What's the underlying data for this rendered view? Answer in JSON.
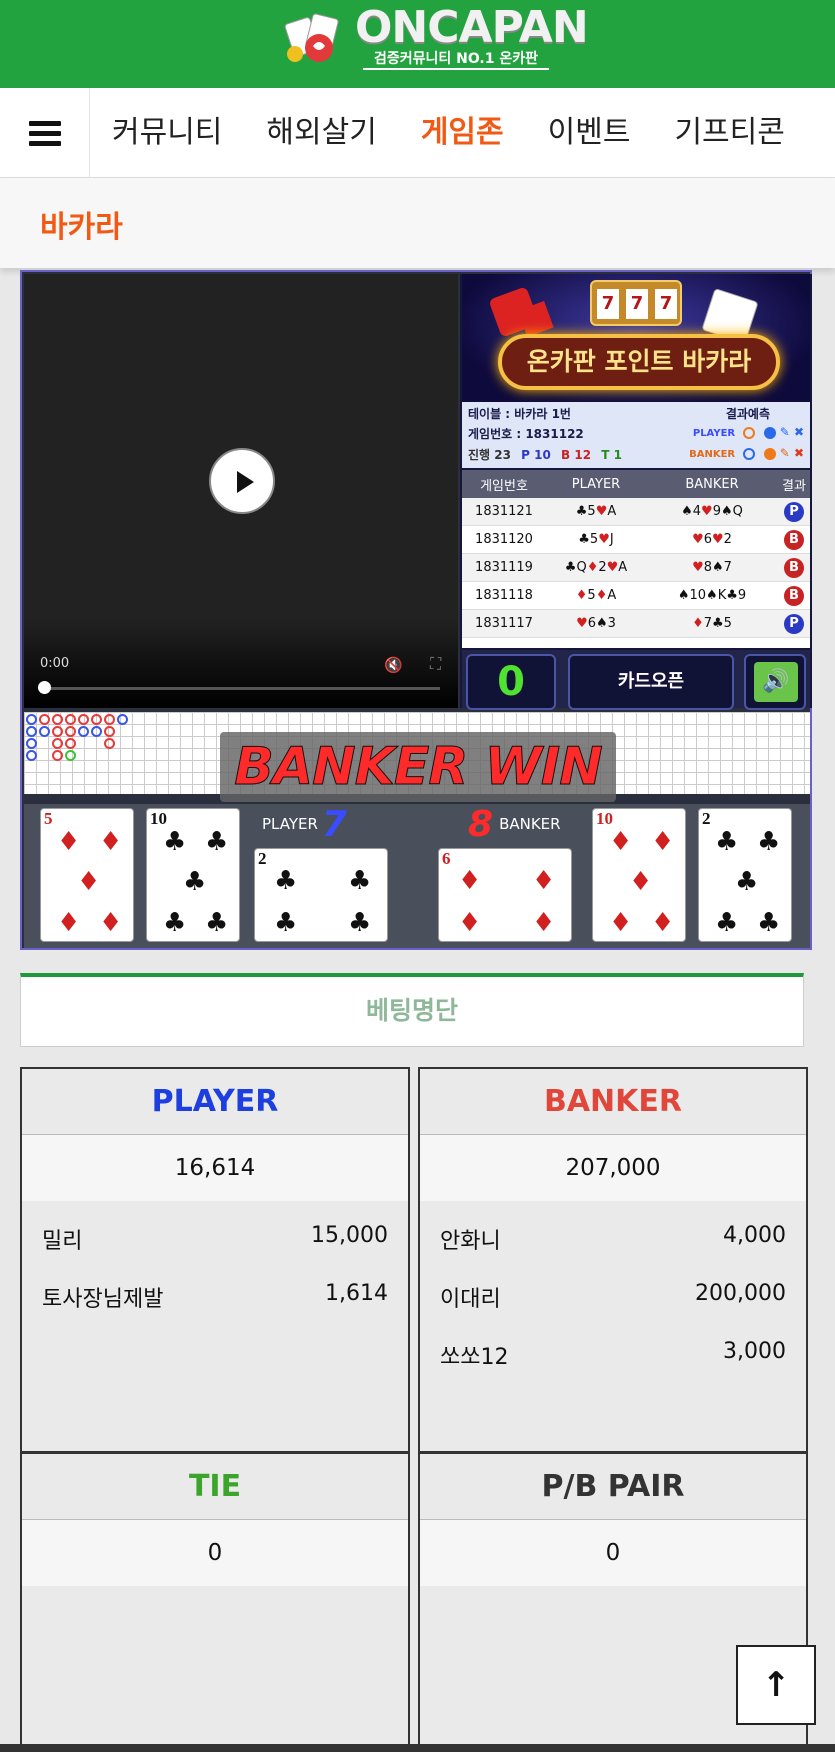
{
  "brand": {
    "name": "ONCAPAN",
    "tagline": "검증커뮤니티 NO.1 온카판"
  },
  "nav": {
    "items": [
      "커뮤니티",
      "해외살기",
      "게임존",
      "이벤트",
      "기프티콘"
    ],
    "active": "게임존"
  },
  "page": {
    "title": "바카라"
  },
  "video": {
    "time": "0:00"
  },
  "game": {
    "banner_title": "온카판 포인트 바카라",
    "slot_symbols": [
      "7",
      "7",
      "7"
    ],
    "table_label": "테이블 : 바카라 1번",
    "game_number_label": "게임번호 : 1831122",
    "progress_label": "진행 23",
    "player_count": "P 10",
    "banker_count": "B 12",
    "tie_count": "T 1",
    "prediction_label": "결과예측",
    "player_tag": "PLAYER",
    "banker_tag": "BANKER",
    "history_headers": [
      "게임번호",
      "PLAYER",
      "BANKER",
      "결과"
    ],
    "history": [
      {
        "id": "1831121",
        "player": "♣5♥A",
        "banker": "♠4♥9♠Q",
        "result": "P"
      },
      {
        "id": "1831120",
        "player": "♣5♥J",
        "banker": "♥6♥2",
        "result": "B"
      },
      {
        "id": "1831119",
        "player": "♣Q♦2♥A",
        "banker": "♥8♠7",
        "result": "B"
      },
      {
        "id": "1831118",
        "player": "♦5♦A",
        "banker": "♠10♠K♣9",
        "result": "B"
      },
      {
        "id": "1831117",
        "player": "♥6♠3",
        "banker": "♦7♣5",
        "result": "P"
      }
    ],
    "counter": "0",
    "card_open_label": "카드오픈",
    "result_banner": "BANKER WIN",
    "player_label": "PLAYER",
    "player_score": "7",
    "banker_label": "BANKER",
    "banker_score": "8",
    "cards": [
      {
        "rank": "5",
        "suit": "♦",
        "color": "#d02020"
      },
      {
        "rank": "10",
        "suit": "♣",
        "color": "#111111"
      },
      {
        "rank": "2",
        "suit": "♣",
        "color": "#111111"
      },
      {
        "rank": "6",
        "suit": "♦",
        "color": "#d02020"
      },
      {
        "rank": "10",
        "suit": "♦",
        "color": "#d02020"
      },
      {
        "rank": "2",
        "suit": "♣",
        "color": "#111111"
      }
    ]
  },
  "betting": {
    "header": "베팅명단",
    "player": {
      "title": "PLAYER",
      "color": "#1e3fe0",
      "total": "16,614",
      "entries": [
        {
          "name": "밀리",
          "amount": "15,000"
        },
        {
          "name": "토사장님제발",
          "amount": "1,614"
        }
      ]
    },
    "banker": {
      "title": "BANKER",
      "color": "#e0473a",
      "total": "207,000",
      "entries": [
        {
          "name": "안화니",
          "amount": "4,000"
        },
        {
          "name": "이대리",
          "amount": "200,000"
        },
        {
          "name": "쏘쏘12",
          "amount": "3,000"
        }
      ]
    },
    "tie": {
      "title": "TIE",
      "color": "#3aa52a",
      "total": "0"
    },
    "pair": {
      "title": "P/B PAIR",
      "color": "#333333",
      "total": "0"
    }
  },
  "colors": {
    "brand_green": "#23a33f",
    "accent_orange": "#f05a14"
  }
}
